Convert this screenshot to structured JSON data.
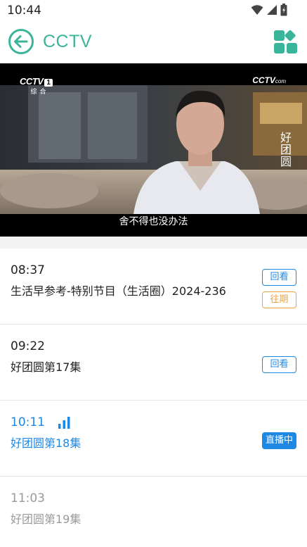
{
  "status_bar": {
    "time": "10:44"
  },
  "app_bar": {
    "title": "CCTV"
  },
  "player": {
    "subtitle": "舍不得也没办法",
    "channel_logo_text": "CCTV",
    "channel_number": "1",
    "channel_sub": "综合",
    "corner_logo_text": "CCTV",
    "corner_logo_domain": "com",
    "show_logo_text": "好团圆"
  },
  "schedule": [
    {
      "time": "08:37",
      "title": "生活早参考-特别节目（生活圈）2024-236",
      "badges": [
        "回看",
        "往期"
      ],
      "state": "past"
    },
    {
      "time": "09:22",
      "title": "好团圆第17集",
      "badges": [
        "回看"
      ],
      "state": "past"
    },
    {
      "time": "10:11",
      "title": "好团圆第18集",
      "badges": [
        "直播中"
      ],
      "state": "live"
    },
    {
      "time": "11:03",
      "title": "好团圆第19集",
      "badges": [],
      "state": "future"
    }
  ],
  "colors": {
    "accent_green": "#3bb59a",
    "live_blue": "#1e88e5",
    "archive_orange": "#f0a33c",
    "future_gray": "#9a9a9a"
  }
}
